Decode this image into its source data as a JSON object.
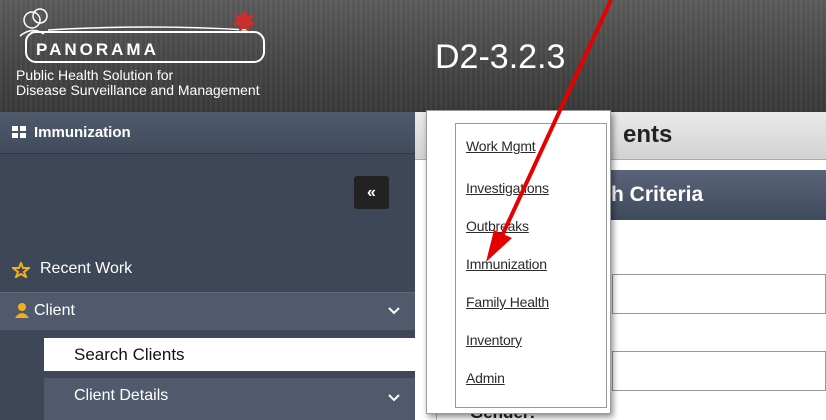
{
  "header": {
    "logo_word": "PANORAMA",
    "logo_subtitle_line1": "Public Health Solution for",
    "logo_subtitle_line2": "Disease Surveillance and Management",
    "version": "D2-3.2.3"
  },
  "sidebar": {
    "module_label": "Immunization",
    "collapse_label": "«",
    "items": [
      {
        "label": "Recent Work",
        "icon": "star-icon"
      },
      {
        "label": "Client",
        "icon": "person-icon"
      },
      {
        "label": "Search Clients"
      },
      {
        "label": "Client Details"
      }
    ]
  },
  "main": {
    "page_title": "ents",
    "criteria_title": "h Criteria",
    "gender_label": "Gender:"
  },
  "module_menu": {
    "items": [
      "Work Mgmt",
      "Investigations",
      "Outbreaks",
      "Immunization",
      "Family Health",
      "Inventory",
      "Admin"
    ]
  },
  "colors": {
    "header_bg": "#474747",
    "sidebar_bg": "#3e4757",
    "annotation_arrow": "#e60000",
    "accent_icon": "#f2b01e"
  }
}
